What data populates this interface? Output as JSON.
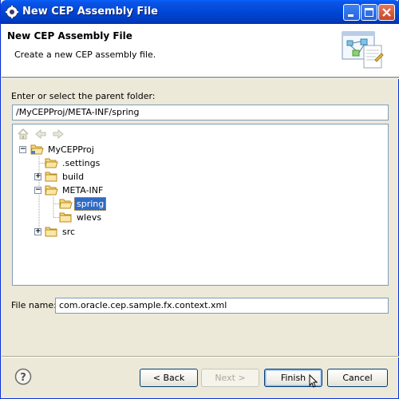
{
  "window": {
    "title": "New CEP Assembly File"
  },
  "banner": {
    "title": "New CEP Assembly File",
    "description": "Create a new CEP assembly file."
  },
  "parent_folder": {
    "label": "Enter or select the parent folder:",
    "value": "/MyCEPProj/META-INF/spring"
  },
  "tree": {
    "toolbar": [
      "home-icon",
      "back-icon",
      "forward-icon"
    ],
    "items": [
      {
        "label": "MyCEPProj",
        "level": 0,
        "expander": "minus",
        "type": "project"
      },
      {
        "label": ".settings",
        "level": 1,
        "expander": "none",
        "type": "folder"
      },
      {
        "label": "build",
        "level": 1,
        "expander": "plus",
        "type": "folder"
      },
      {
        "label": "META-INF",
        "level": 1,
        "expander": "minus",
        "type": "folder-open"
      },
      {
        "label": "spring",
        "level": 2,
        "expander": "none",
        "type": "folder-open",
        "selected": true
      },
      {
        "label": "wlevs",
        "level": 2,
        "expander": "none",
        "type": "folder"
      },
      {
        "label": "src",
        "level": 1,
        "expander": "plus",
        "type": "folder"
      }
    ]
  },
  "file_name": {
    "label": "File name:",
    "value": "com.oracle.cep.sample.fx.context.xml"
  },
  "buttons": {
    "back": "< Back",
    "next": "Next >",
    "finish": "Finish",
    "cancel": "Cancel"
  },
  "colors": {
    "titlebar": "#0047d6",
    "selection": "#316ac5",
    "dialog_bg": "#ece9d8"
  }
}
